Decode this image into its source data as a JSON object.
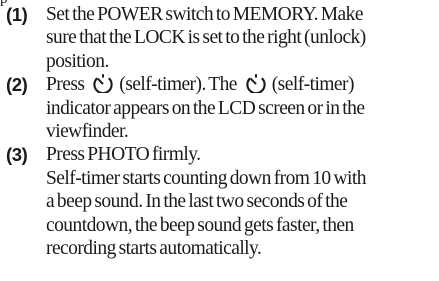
{
  "top_fragment": "p",
  "steps": [
    {
      "number": "(1)",
      "lines": [
        "Set the POWER switch to MEMORY. Make",
        "sure that the LOCK is set to the right (unlock)",
        "position."
      ]
    },
    {
      "number": "(2)",
      "line1_a": "Press",
      "line1_b": "(self-timer). The",
      "line1_c": "(self-timer)",
      "lines": [
        "indicator appears on the LCD screen or in the",
        "viewfinder."
      ],
      "icon": "self-timer-icon"
    },
    {
      "number": "(3)",
      "lines": [
        "Press PHOTO firmly.",
        "Self-timer starts counting down from 10 with",
        "a beep sound. In the last two seconds of the",
        "countdown, the beep sound gets faster, then",
        "recording starts automatically."
      ]
    }
  ]
}
